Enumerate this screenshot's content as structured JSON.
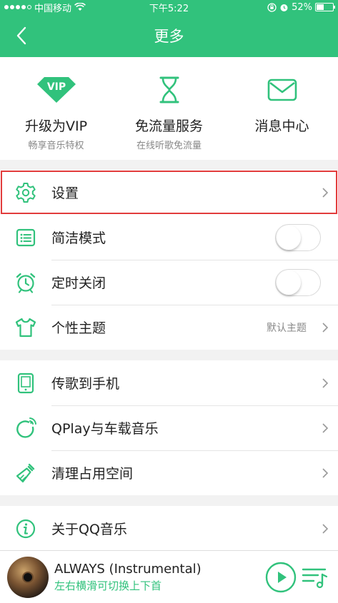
{
  "status": {
    "carrier": "中国移动",
    "time": "下午5:22",
    "battery": "52%",
    "battery_level": 0.52
  },
  "header": {
    "title": "更多"
  },
  "quick_actions": [
    {
      "icon": "vip-diamond-icon",
      "title": "升级为VIP",
      "subtitle": "畅享音乐特权"
    },
    {
      "icon": "hourglass-icon",
      "title": "免流量服务",
      "subtitle": "在线听歌免流量"
    },
    {
      "icon": "envelope-icon",
      "title": "消息中心",
      "subtitle": ""
    }
  ],
  "section1": {
    "settings": {
      "label": "设置",
      "icon": "gear-icon"
    },
    "simple_mode": {
      "label": "简洁模式",
      "icon": "list-icon",
      "on": false
    },
    "timer": {
      "label": "定时关闭",
      "icon": "alarm-clock-icon",
      "on": false
    },
    "theme": {
      "label": "个性主题",
      "value": "默认主题",
      "icon": "tshirt-icon"
    }
  },
  "section2": {
    "transfer": {
      "label": "传歌到手机",
      "icon": "tablet-icon"
    },
    "qplay": {
      "label": "QPlay与车载音乐",
      "icon": "qplay-icon"
    },
    "clean": {
      "label": "清理占用空间",
      "icon": "broom-icon"
    }
  },
  "section3": {
    "about": {
      "label": "关于QQ音乐",
      "icon": "info-icon"
    }
  },
  "player": {
    "song": "ALWAYS (Instrumental)",
    "hint": "左右横滑可切换上下首"
  },
  "colors": {
    "brand": "#31c27c",
    "highlight": "#e23c3c"
  }
}
